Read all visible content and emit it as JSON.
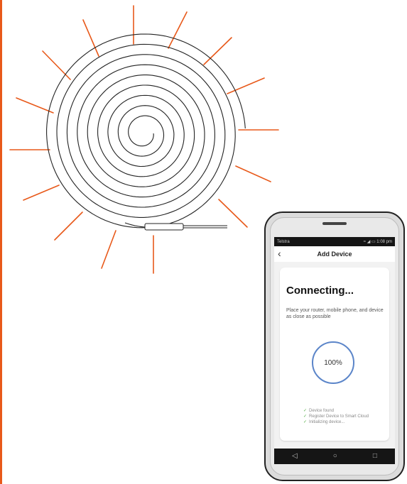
{
  "colors": {
    "accent": "#e8591a",
    "ring": "#5b85c9",
    "check": "#57b04a"
  },
  "illustration": {
    "icon": "spiral-heater-icon",
    "ray_icon": "light-ray-icon"
  },
  "phone": {
    "status_bar": {
      "carrier": "Telstra",
      "right": "≈ ◢ ▭ 1:08 pm"
    },
    "header": {
      "back_icon": "‹",
      "title": "Add Device"
    },
    "content": {
      "headline": "Connecting...",
      "subtext": "Place your router, mobile phone, and device as close as possible",
      "progress": 100,
      "progress_label": "100%",
      "steps": [
        {
          "check": "✓",
          "label": "Device found"
        },
        {
          "check": "✓",
          "label": "Register Device to Smart Cloud"
        },
        {
          "check": "✓",
          "label": "Initializing device..."
        }
      ]
    },
    "nav": {
      "back": "◁",
      "home": "○",
      "recents": "□"
    }
  }
}
